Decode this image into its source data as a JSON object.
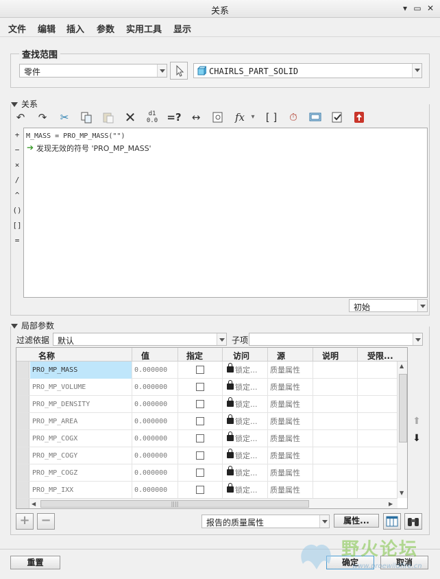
{
  "window": {
    "title": "关系",
    "controls": [
      "▾",
      "▭",
      "✕"
    ]
  },
  "menu": [
    "文件",
    "编辑",
    "插入",
    "参数",
    "实用工具",
    "显示"
  ],
  "lookup": {
    "label": "查找范围",
    "scope_value": "零件",
    "part_value": "CHAIRLS_PART_SOLID"
  },
  "relations": {
    "label": "关系",
    "toolbar_icons": [
      "undo-icon",
      "redo-icon",
      "cut-icon",
      "copy-icon",
      "paste-icon",
      "delete-icon",
      "switch-dims-icon",
      "evaluate-icon",
      "measure-icon",
      "insert-from-list-icon",
      "function-icon",
      "parameter-bracket-icon",
      "sort-icon",
      "display-icon",
      "verify-icon",
      "export-icon"
    ],
    "operators": [
      "+",
      "−",
      "×",
      "/",
      "^",
      "()",
      "[]",
      "="
    ],
    "code_line": "M_MASS = PRO_MP_MASS(\"\")",
    "error_line": "发现无效的符号 'PRO_MP_MASS'",
    "state_value": "初始",
    "accent": "#3a9a2a"
  },
  "local_params": {
    "label": "局部参数",
    "filter_label": "过滤依据",
    "filter_value": "默认",
    "child_label": "子项",
    "child_value": "",
    "columns": [
      "名称",
      "值",
      "指定",
      "访问",
      "源",
      "说明",
      "受限..."
    ],
    "rows": [
      {
        "name": "PRO_MP_MASS",
        "value": "0.000000",
        "access": "锁定...",
        "source": "质量属性"
      },
      {
        "name": "PRO_MP_VOLUME",
        "value": "0.000000",
        "access": "锁定...",
        "source": "质量属性"
      },
      {
        "name": "PRO_MP_DENSITY",
        "value": "0.000000",
        "access": "锁定...",
        "source": "质量属性"
      },
      {
        "name": "PRO_MP_AREA",
        "value": "0.000000",
        "access": "锁定...",
        "source": "质量属性"
      },
      {
        "name": "PRO_MP_COGX",
        "value": "0.000000",
        "access": "锁定...",
        "source": "质量属性"
      },
      {
        "name": "PRO_MP_COGY",
        "value": "0.000000",
        "access": "锁定...",
        "source": "质量属性"
      },
      {
        "name": "PRO_MP_COGZ",
        "value": "0.000000",
        "access": "锁定...",
        "source": "质量属性"
      },
      {
        "name": "PRO_MP_IXX",
        "value": "0.000000",
        "access": "锁定...",
        "source": "质量属性"
      }
    ],
    "hscroll_grip": "||||",
    "mass_report_value": "报告的质量属性",
    "properties_button": "属性...",
    "selected_row_color": "#bfe6fb"
  },
  "footer": {
    "reset": "重置",
    "ok": "确定",
    "cancel": "取消"
  },
  "watermark": {
    "text": "野火论坛",
    "url": "www.proewildfire.cn"
  }
}
